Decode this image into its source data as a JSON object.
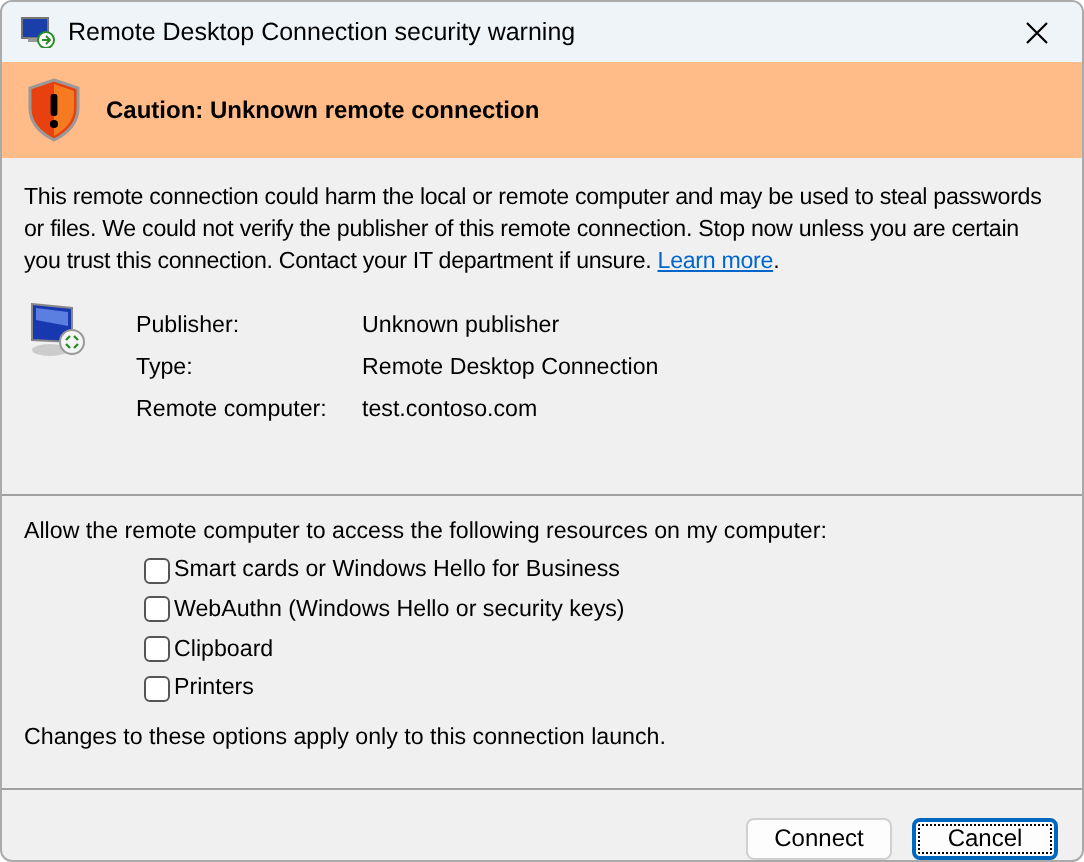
{
  "window": {
    "title": "Remote Desktop Connection security warning"
  },
  "banner": {
    "title": "Caution: Unknown remote connection"
  },
  "message": {
    "text": "This remote connection could harm the local or remote computer and may be used to steal passwords or files. We could not verify the publisher of this remote connection. Stop now unless you are certain you trust this connection. Contact your IT department if unsure.",
    "link": "Learn more",
    "after": "."
  },
  "details": [
    {
      "label": "Publisher:",
      "value": "Unknown publisher"
    },
    {
      "label": "Type:",
      "value": "Remote Desktop Connection"
    },
    {
      "label": "Remote computer:",
      "value": "test.contoso.com"
    }
  ],
  "resources": {
    "heading": "Allow the remote computer to access the following resources on my computer:",
    "options": [
      {
        "label": "Smart cards or Windows Hello for Business",
        "checked": false
      },
      {
        "label": "WebAuthn (Windows Hello or security keys)",
        "checked": false
      },
      {
        "label": "Clipboard",
        "checked": false
      },
      {
        "label": "Printers",
        "checked": false
      }
    ],
    "note": "Changes to these options apply only to this connection launch."
  },
  "buttons": [
    {
      "label": "Connect",
      "selected": false
    },
    {
      "label": "Cancel",
      "selected": true
    }
  ]
}
